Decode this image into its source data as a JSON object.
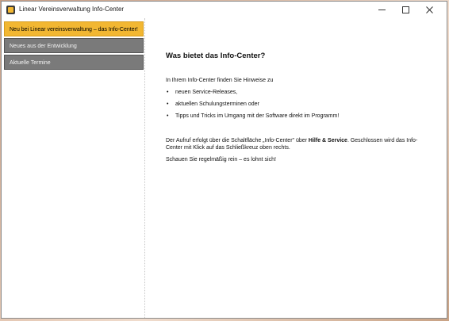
{
  "window": {
    "title": "Linear Vereinsverwaltung Info-Center"
  },
  "sidebar": {
    "items": [
      {
        "label": "Neu bei Linear vereinsverwaltung – das Info-Center!"
      },
      {
        "label": "Neues aus der Entwicklung"
      },
      {
        "label": "Aktuelle Termine"
      }
    ]
  },
  "content": {
    "heading": "Was bietet das Info-Center?",
    "intro": "In Ihrem Info-Center finden Sie Hinweise zu",
    "bullets": [
      "neuen Service-Releases,",
      "aktuellen Schulungsterminen oder",
      "Tipps und Tricks im Umgang mit der Software direkt im Programm!"
    ],
    "para1_before": "Der Aufruf erfolgt über die Schaltfläche „Info-Center\" über ",
    "para1_bold": "Hilfe & Service",
    "para1_after": ". Geschlossen wird das Info-Center mit Klick auf das Schließkreuz oben rechts.",
    "para2": "Schauen Sie regelmäßig rein – es lohnt sich!"
  }
}
